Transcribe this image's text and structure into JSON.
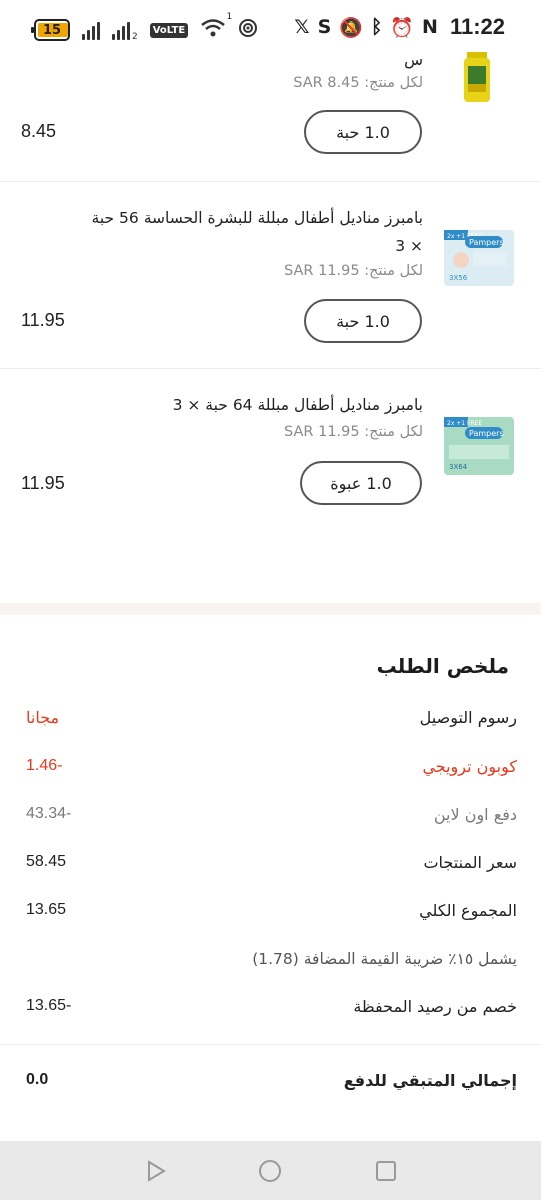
{
  "status_bar": {
    "battery_level": "15",
    "sim_slot": "2",
    "volte": "VoLTE",
    "wifi_superscript": "1",
    "time": "11:22",
    "icons": [
      "x-icon",
      "s-icon",
      "bell-off-icon",
      "bluetooth-icon",
      "alarm-icon",
      "nfc-icon"
    ]
  },
  "products": [
    {
      "title": "س",
      "unit_price": "لكل منتج: SAR 8.45",
      "quantity": "1.0 حبة",
      "line_total": "8.45",
      "thumb": "oil-bottle-image"
    },
    {
      "title": "بامبرز مناديل أطفال مبللة للبشرة الحساسة 56 حبة × 3",
      "unit_price": "لكل منتج: SAR 11.95",
      "quantity": "1.0 حبة",
      "line_total": "11.95",
      "thumb": "pampers-sensitive-wipes-image",
      "thumb_badge": "2x +1 FREE",
      "thumb_count": "3X56",
      "thumb_brand": "Pampers"
    },
    {
      "title": "بامبرز مناديل أطفال مبللة 64 حبة × 3",
      "unit_price": "لكل منتج: SAR 11.95",
      "quantity": "1.0 عبوة",
      "line_total": "11.95",
      "thumb": "pampers-fresh-wipes-image",
      "thumb_badge": "2x +1 FREE",
      "thumb_count": "3X64",
      "thumb_brand": "Pampers"
    }
  ],
  "summary": {
    "title": "ملخص الطلب",
    "rows": [
      {
        "label": "رسوم التوصيل",
        "value": "مجانا"
      },
      {
        "label": "كوبون ترويجي",
        "value": "1.46-"
      },
      {
        "label": "دفع اون لاين",
        "value": "43.34-"
      },
      {
        "label": "سعر المنتجات",
        "value": "58.45"
      },
      {
        "label": "المجموع الكلي",
        "value": "13.65"
      }
    ],
    "vat_note": "يشمل ١٥٪ ضريبة القيمة المضافة (1.78)",
    "wallet_row": {
      "label": "خصم من رصيد المحفظة",
      "value": "13.65-"
    },
    "total_row": {
      "label": "إجمالي المتبقي للدفع",
      "value": "0.0"
    }
  },
  "colors": {
    "accent_red": "#e8391d",
    "muted_gray": "#7a7a7a",
    "section_gap": "#f7f4f1",
    "nav_bar": "#e9e9e9",
    "battery": "#f0a500"
  },
  "nav": {
    "icons": [
      "back-triangle-icon",
      "home-circle-icon",
      "recents-square-icon"
    ]
  }
}
